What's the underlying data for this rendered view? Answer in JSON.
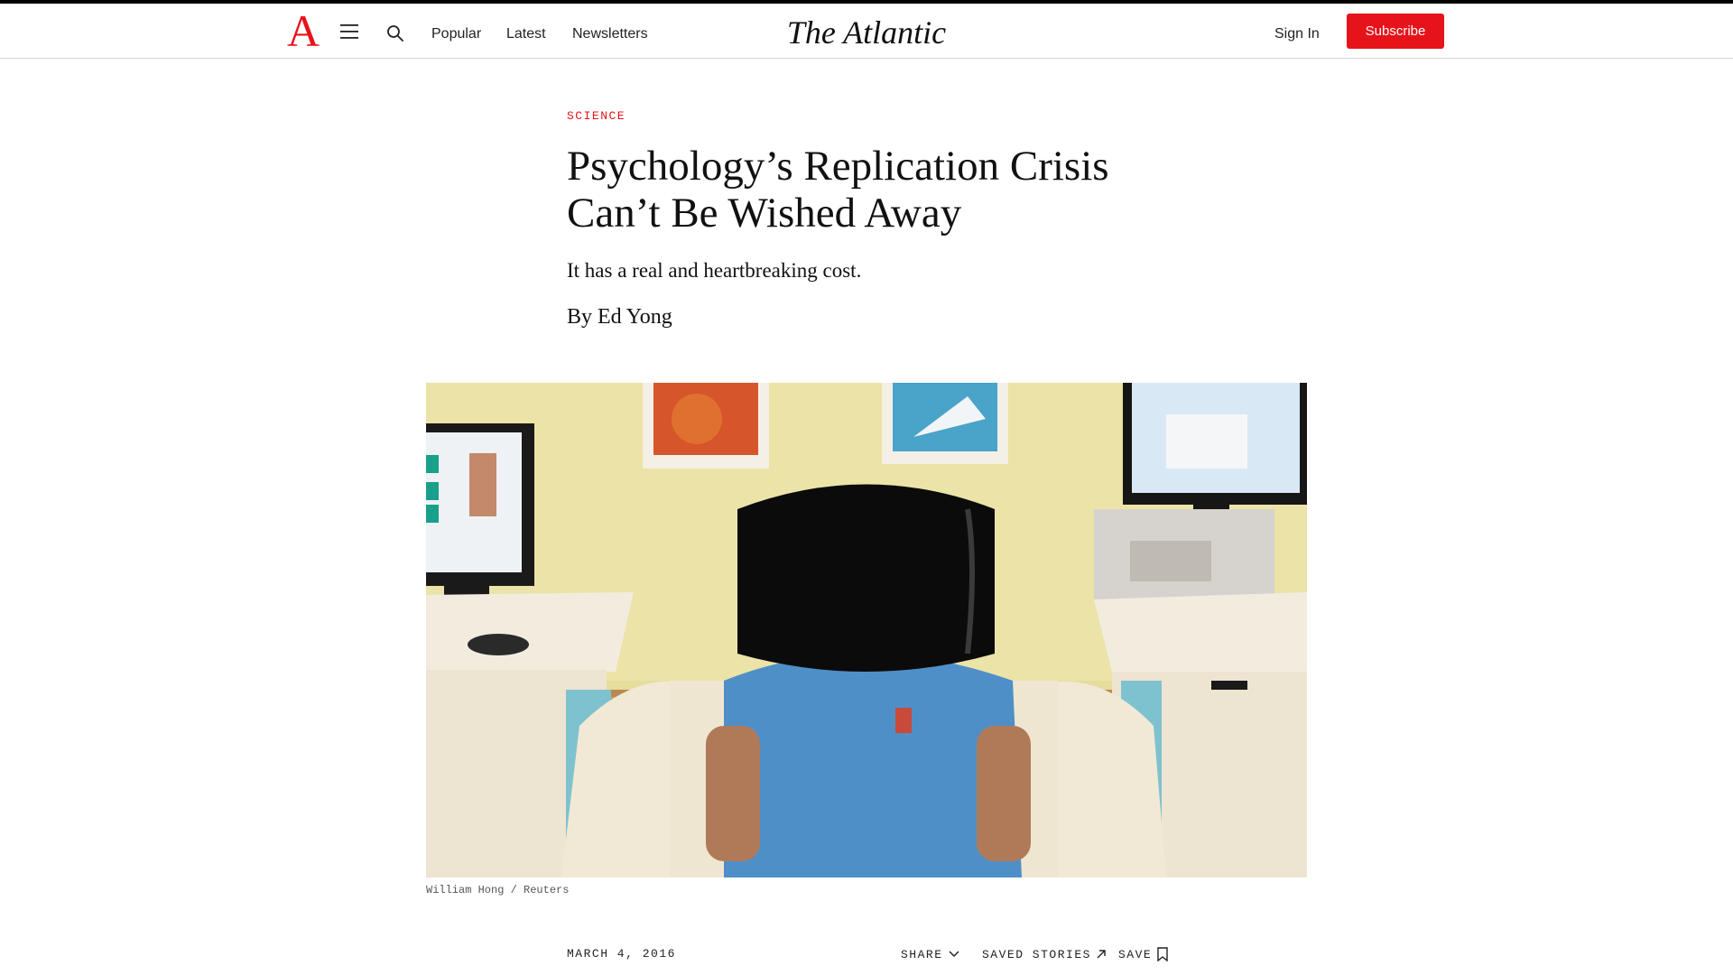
{
  "header": {
    "logo_letter": "A",
    "menu_icon": "hamburger-menu-icon",
    "search_icon": "search-icon",
    "nav": [
      {
        "label": "Popular"
      },
      {
        "label": "Latest"
      },
      {
        "label": "Newsletters"
      }
    ],
    "wordmark": "The Atlantic",
    "sign_in": "Sign In",
    "subscribe": "Subscribe",
    "accent_color": "#e7131a"
  },
  "article": {
    "section": "SCIENCE",
    "headline": "Psychology’s Replication Crisis Can’t Be Wished Away",
    "dek": "It has a real and heartbreaking cost.",
    "byline_prefix": "By ",
    "author": "Ed Yong",
    "photo_caption": "William Hong / Reuters",
    "date": "MARCH 4, 2016"
  },
  "toolbar": {
    "share": "SHARE",
    "share_icon": "chevron-down-icon",
    "saved_stories": "SAVED STORIES",
    "saved_stories_icon": "arrow-up-right-icon",
    "save": "SAVE",
    "save_icon": "bookmark-icon"
  }
}
